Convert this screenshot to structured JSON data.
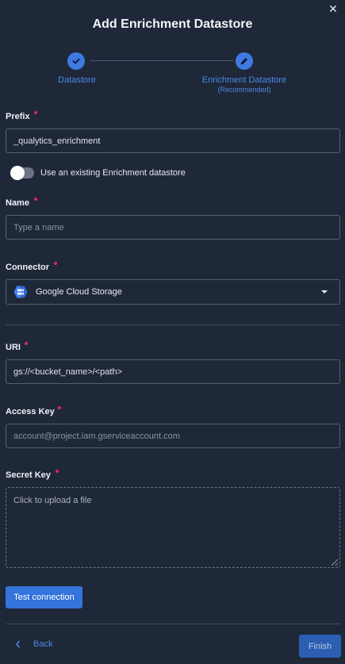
{
  "dialog": {
    "title": "Add Enrichment Datastore",
    "close_glyph": "✕"
  },
  "stepper": {
    "steps": [
      {
        "label": "Datastore",
        "sublabel": "",
        "icon": "check-icon"
      },
      {
        "label": "Enrichment Datastore",
        "sublabel": "(Recommended)",
        "icon": "pencil-icon"
      }
    ]
  },
  "form": {
    "prefix": {
      "label": "Prefix",
      "value": "_qualytics_enrichment"
    },
    "use_existing": {
      "label": "Use an existing Enrichment datastore",
      "checked": false
    },
    "name": {
      "label": "Name",
      "value": "",
      "placeholder": "Type a name"
    },
    "connector": {
      "label": "Connector",
      "value": "Google Cloud Storage",
      "icon": "google-cloud-storage-icon"
    },
    "uri": {
      "label": "URI",
      "value": "gs://<bucket_name>/<path>"
    },
    "access_key": {
      "label": "Access Key",
      "value": "",
      "placeholder": "account@project.iam.gserviceaccount.com"
    },
    "secret_key": {
      "label": "Secret Key",
      "upload_text": "Click to upload a file"
    }
  },
  "actions": {
    "test_connection": "Test connection",
    "back": "Back",
    "finish": "Finish"
  },
  "colors": {
    "background": "#1f2838",
    "accent": "#3d7be0",
    "required": "#e0245e"
  }
}
